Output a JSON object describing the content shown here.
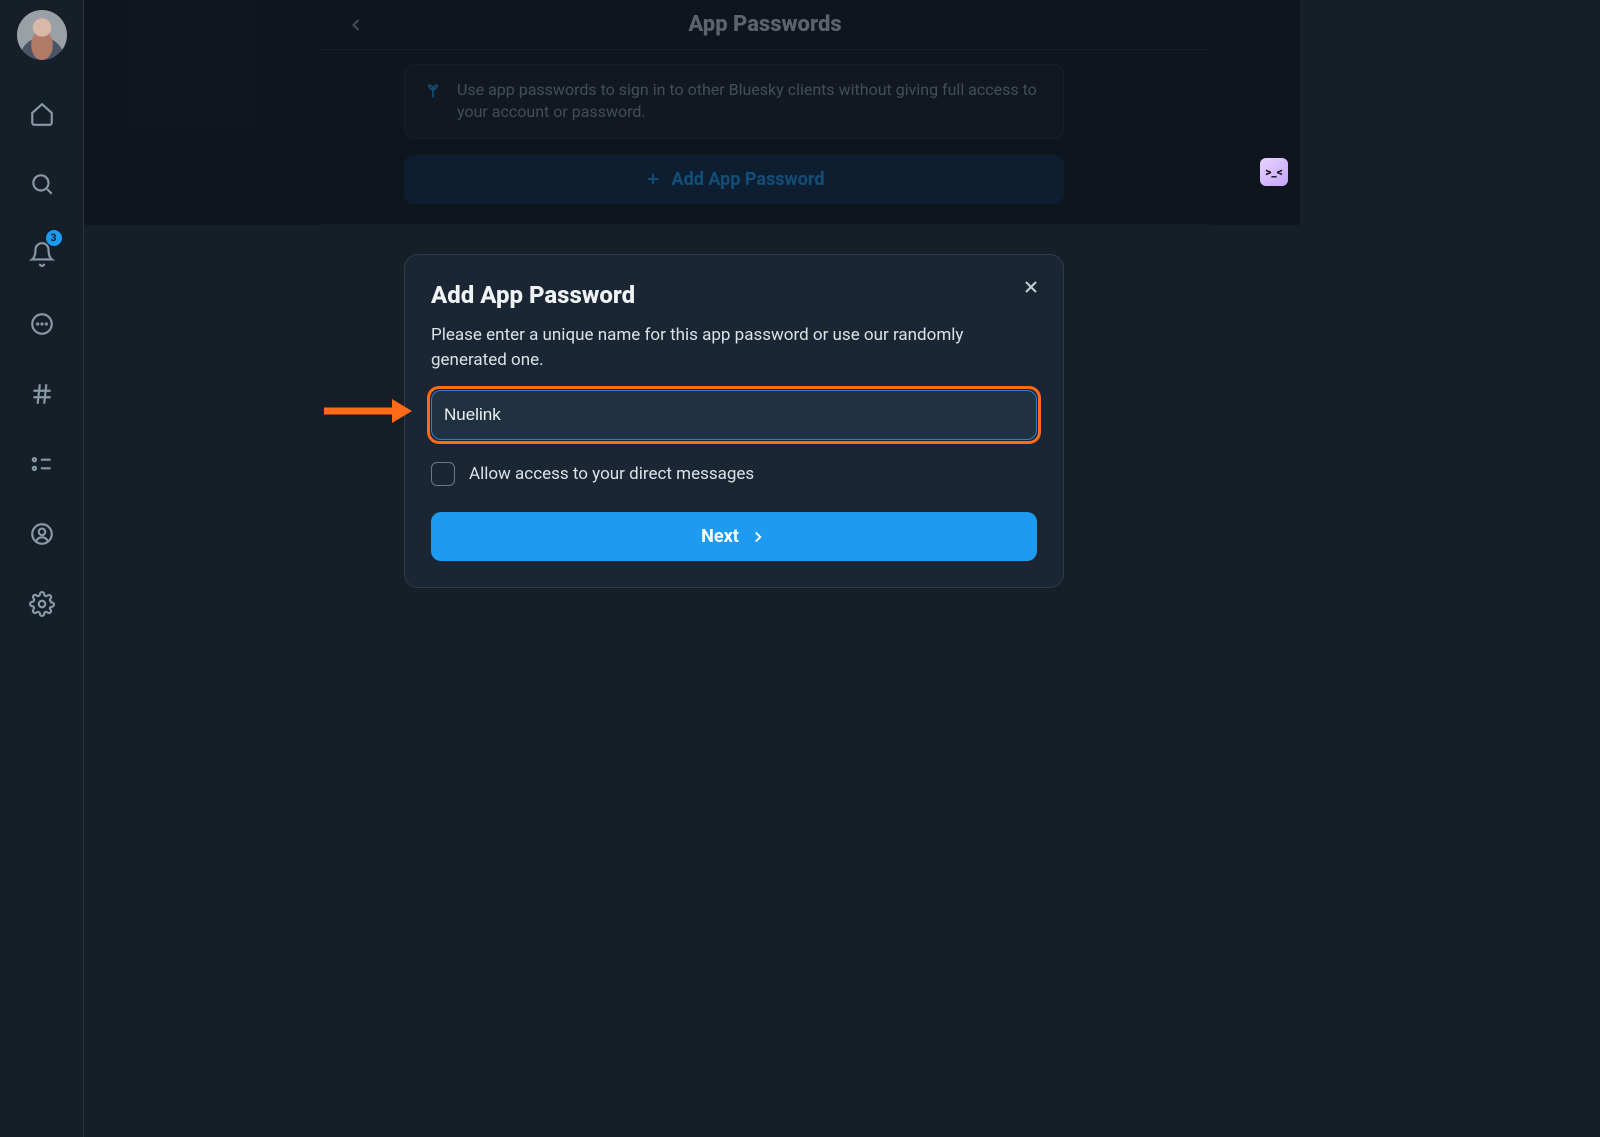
{
  "sidebar": {
    "badge_count": "3"
  },
  "page": {
    "title": "App Passwords",
    "info_text": "Use app passwords to sign in to other Bluesky clients without giving full access to your account or password.",
    "add_button_label": "Add App Password"
  },
  "modal": {
    "title": "Add App Password",
    "description": "Please enter a unique name for this app password or use our randomly generated one.",
    "input_value": "Nuelink",
    "checkbox_label": "Allow access to your direct messages",
    "next_label": "Next"
  },
  "widget": {
    "glyph": ">_<"
  }
}
